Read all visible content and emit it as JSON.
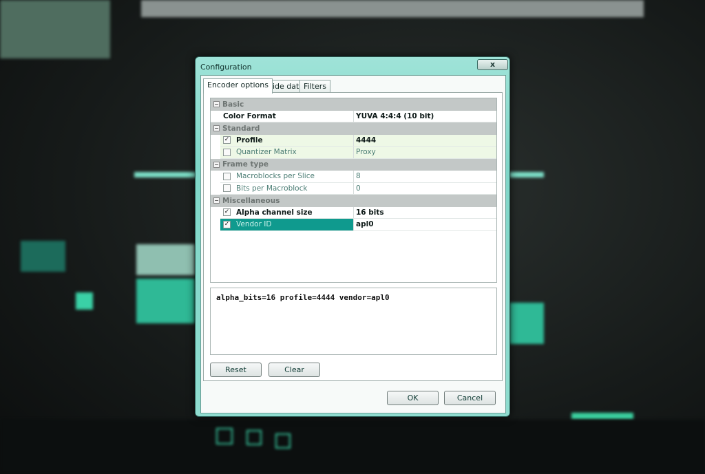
{
  "dialog": {
    "title": "Configuration",
    "close_label": "x"
  },
  "tabs": [
    {
      "label": "Encoder options",
      "active": true
    },
    {
      "label": "Side data"
    },
    {
      "label": "Filters"
    }
  ],
  "grid": {
    "categories": {
      "basic": "Basic",
      "standard": "Standard",
      "frame_type": "Frame type",
      "misc": "Miscellaneous"
    },
    "color_format": {
      "name": "Color Format",
      "value": "YUVA 4:4:4 (10 bit)"
    },
    "profile": {
      "name": "Profile",
      "value": "4444",
      "checked": true
    },
    "quantizer": {
      "name": "Quantizer Matrix",
      "value": "Proxy",
      "checked": false
    },
    "macroblocks": {
      "name": "Macroblocks per Slice",
      "value": "8",
      "checked": false
    },
    "bits": {
      "name": "Bits per Macroblock",
      "value": "0",
      "checked": false
    },
    "alpha": {
      "name": "Alpha channel size",
      "value": "16 bits",
      "checked": true
    },
    "vendor": {
      "name": "Vendor ID",
      "value": "apl0",
      "checked": true,
      "selected": true
    }
  },
  "output_text": "alpha_bits=16 profile=4444 vendor=apl0",
  "buttons": {
    "reset": "Reset",
    "clear": "Clear",
    "ok": "OK",
    "cancel": "Cancel"
  },
  "colors": {
    "accent": "#0f9a8e",
    "frame": "#8fdccf"
  },
  "check_glyph": "✓",
  "collapse_glyph": "−"
}
